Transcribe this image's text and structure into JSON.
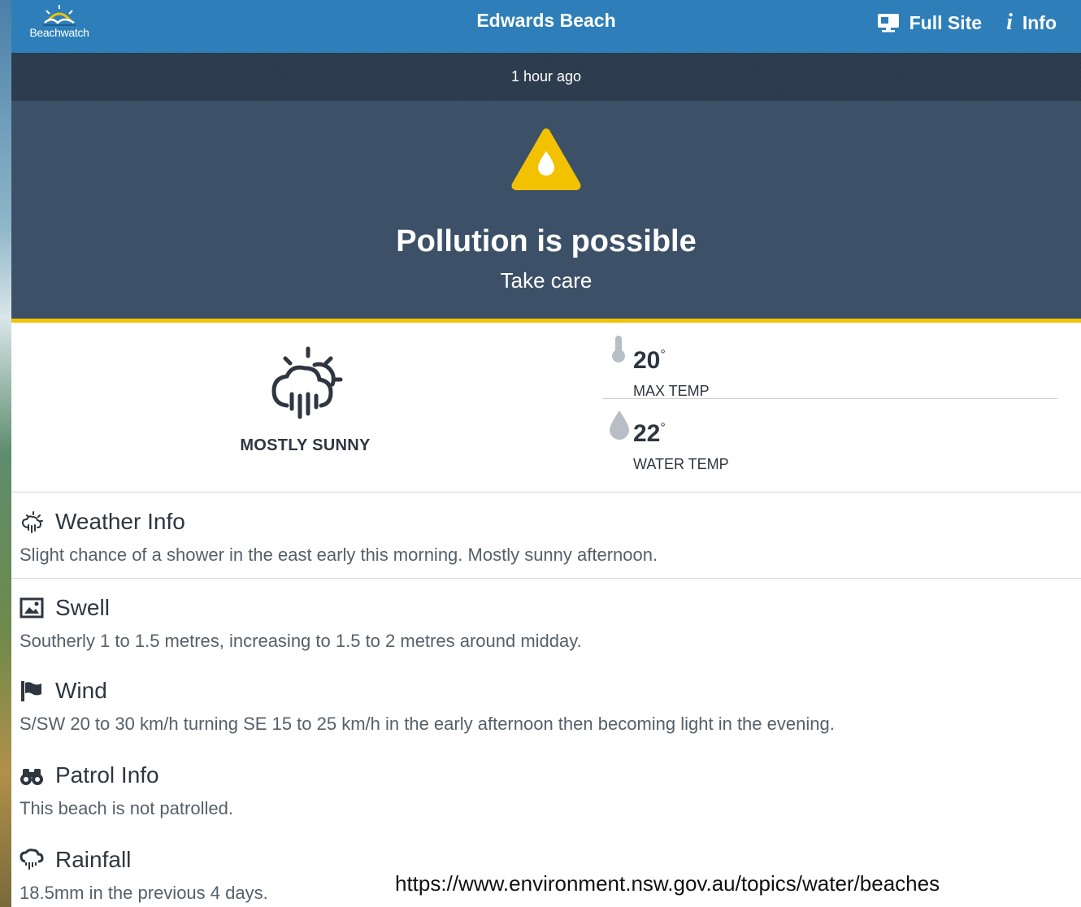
{
  "header": {
    "logo_text": "Beachwatch",
    "title": "Edwards Beach",
    "full_site_label": "Full Site",
    "info_label": "Info"
  },
  "updated": "1 hour ago",
  "status": {
    "title": "Pollution is possible",
    "subtitle": "Take care",
    "accent_color": "#f2c200",
    "icon": "water-drop-warning-icon"
  },
  "weather": {
    "condition": "MOSTLY SUNNY",
    "condition_icon": "sun-cloud-rain-icon",
    "max_temp": {
      "value": "20",
      "unit": "°",
      "label": "MAX TEMP",
      "icon": "thermometer-icon"
    },
    "water_temp": {
      "value": "22",
      "unit": "°",
      "label": "WATER TEMP",
      "icon": "water-drop-icon"
    }
  },
  "sections": [
    {
      "title": "Weather Info",
      "icon": "weather-icon",
      "text": "Slight chance of a shower in the east early this morning. Mostly sunny afternoon."
    },
    {
      "title": "Swell",
      "icon": "image-icon",
      "text": "Southerly 1 to 1.5 metres, increasing to 1.5 to 2 metres around midday."
    },
    {
      "title": "Wind",
      "icon": "flag-icon",
      "text": "S/SW 20 to 30 km/h turning SE 15 to 25 km/h in the early afternoon then becoming light in the evening."
    },
    {
      "title": "Patrol Info",
      "icon": "binoculars-icon",
      "text": "This beach is not patrolled."
    },
    {
      "title": "Rainfall",
      "icon": "rain-cloud-icon",
      "text": "18.5mm in the previous 4 days."
    }
  ],
  "source_url": "https://www.environment.nsw.gov.au/topics/water/beaches",
  "colors": {
    "header": "#2e7fb9",
    "time_bar": "#2a3a4c",
    "status_panel": "#3c5068",
    "text": "#2e3640"
  }
}
